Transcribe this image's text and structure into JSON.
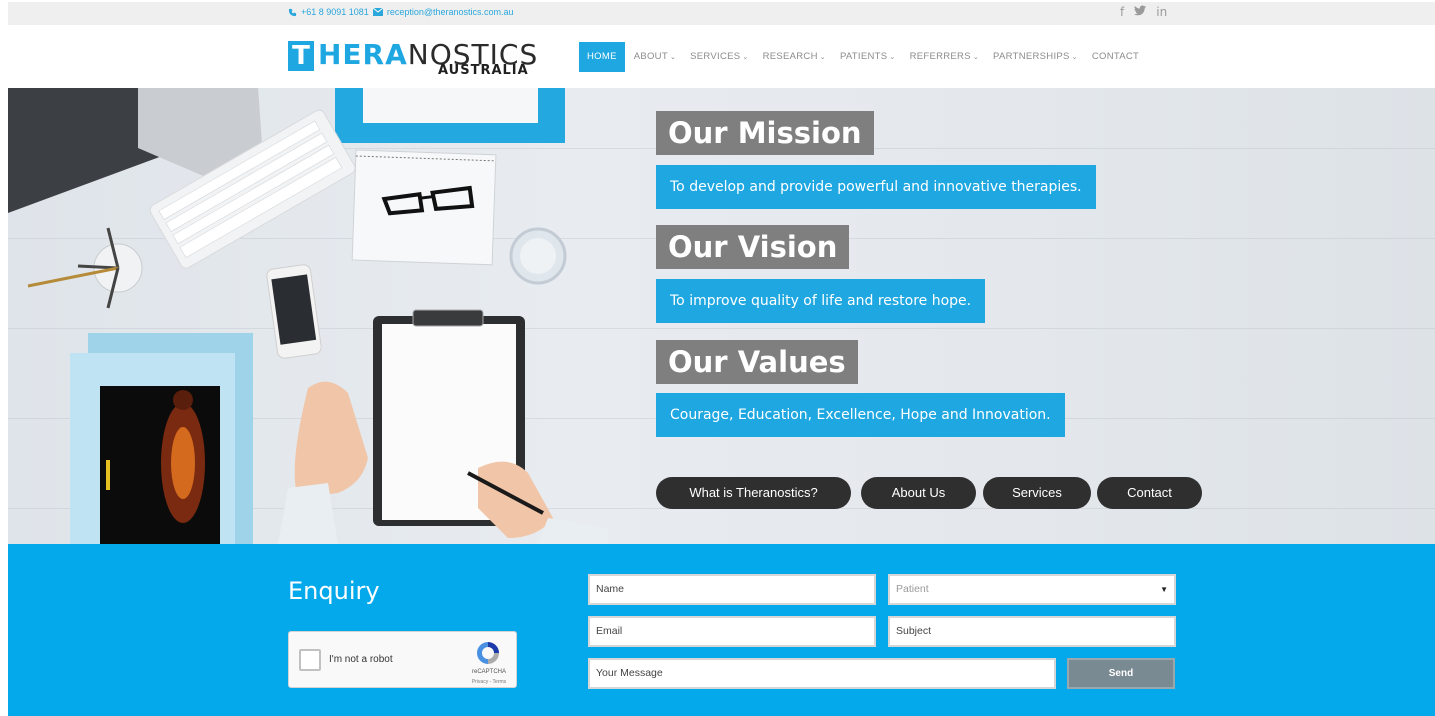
{
  "topbar": {
    "phone": "+61 8 9091 1081",
    "email": "reception@theranostics.com.au",
    "social": [
      {
        "icon": "facebook-icon",
        "label": "f"
      },
      {
        "icon": "twitter-icon",
        "label": "🐦"
      },
      {
        "icon": "linkedin-icon",
        "label": "in"
      }
    ]
  },
  "logo": {
    "letter": "T",
    "word_a": "HERA",
    "word_b": "NOSTICS",
    "sub": "AUSTRALIA"
  },
  "nav": {
    "items": [
      {
        "label": "HOME",
        "dropdown": false,
        "active": true
      },
      {
        "label": "ABOUT",
        "dropdown": true
      },
      {
        "label": "SERVICES",
        "dropdown": true
      },
      {
        "label": "RESEARCH",
        "dropdown": true
      },
      {
        "label": "PATIENTS",
        "dropdown": true
      },
      {
        "label": "REFERRERS",
        "dropdown": true
      },
      {
        "label": "PARTNERSHIPS",
        "dropdown": true
      },
      {
        "label": "CONTACT",
        "dropdown": false
      }
    ],
    "chevron": "⌄"
  },
  "hero": {
    "mission_title": "Our Mission",
    "mission_text": "To develop and provide powerful and innovative therapies.",
    "vision_title": "Our Vision",
    "vision_text": "To improve quality of life and restore hope.",
    "values_title": "Our Values",
    "values_text": "Courage, Education, Excellence, Hope and Innovation.",
    "buttons": [
      "What is Theranostics?",
      "About Us",
      "Services",
      "Contact"
    ]
  },
  "enquiry": {
    "title": "Enquiry",
    "captcha_label": "I'm not a robot",
    "captcha_brand": "reCAPTCHA",
    "captcha_terms": "Privacy - Terms",
    "name_value": "Name",
    "select_value": "Patient",
    "email_value": "Email",
    "subject_value": "Subject",
    "message_value": "Your Message",
    "send_label": "Send"
  },
  "colors": {
    "accent": "#1ea7e1",
    "enquiry_bg": "#04a9ec",
    "heading_bg": "#7f7f7f",
    "button_bg": "#2f2f2f"
  }
}
